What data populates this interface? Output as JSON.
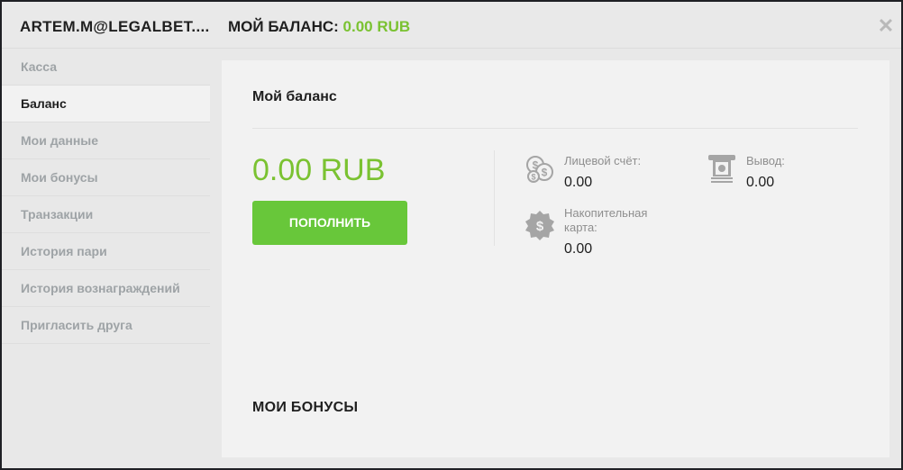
{
  "header": {
    "user": "ARTEM.M@LEGALBET....",
    "balance_label": "МОЙ БАЛАНС:",
    "balance_value": "0.00 RUB",
    "close": "✕"
  },
  "sidebar": {
    "items": [
      {
        "label": "Касса",
        "active": false
      },
      {
        "label": "Баланс",
        "active": true
      },
      {
        "label": "Мои данные",
        "active": false
      },
      {
        "label": "Мои бонусы",
        "active": false
      },
      {
        "label": "Транзакции",
        "active": false
      },
      {
        "label": "История пари",
        "active": false
      },
      {
        "label": "История вознаграждений",
        "active": false
      },
      {
        "label": "Пригласить друга",
        "active": false
      }
    ]
  },
  "main": {
    "title": "Мой баланс",
    "balance": "0.00 RUB",
    "topup_label": "ПОПОЛНИТЬ",
    "account": {
      "label": "Лицевой счёт:",
      "value": "0.00",
      "icon": "coins-icon"
    },
    "withdraw": {
      "label": "Вывод:",
      "value": "0.00",
      "icon": "atm-withdraw-icon"
    },
    "card": {
      "label": "Накопительная карта:",
      "value": "0.00",
      "icon": "dollar-badge-icon"
    },
    "bonuses_title": "МОИ БОНУСЫ"
  },
  "colors": {
    "accent_green": "#7ac231",
    "button_green": "#68c73a"
  }
}
